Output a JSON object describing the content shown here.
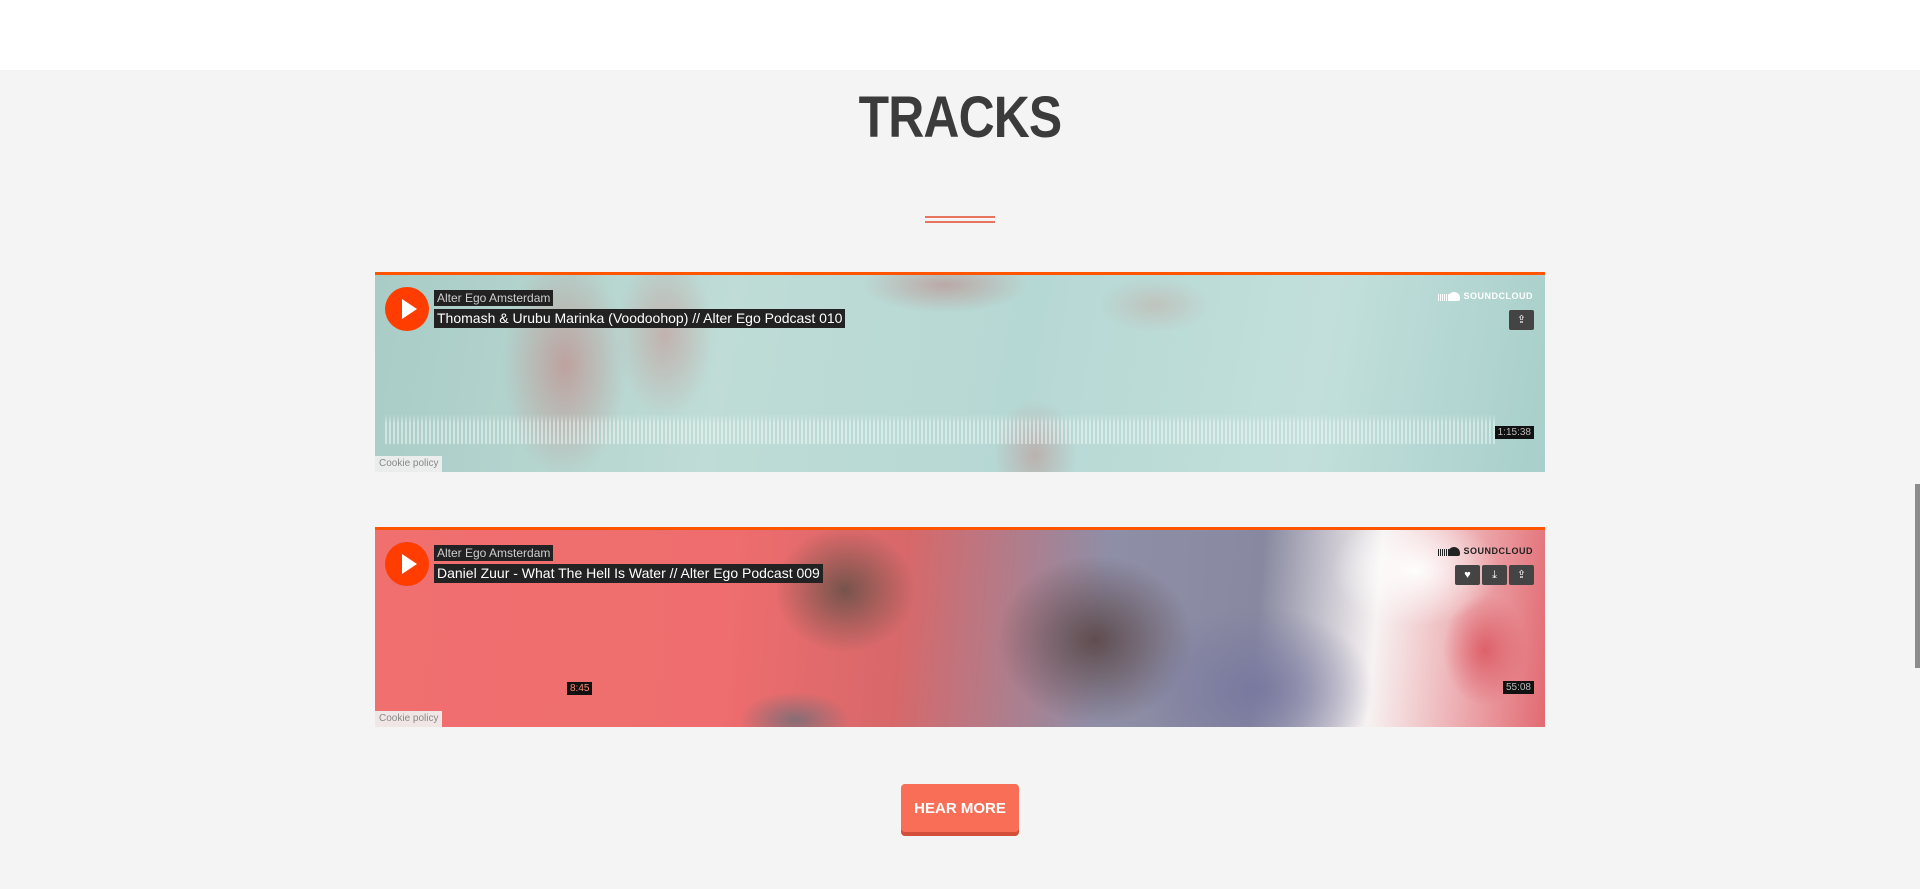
{
  "section": {
    "title": "TRACKS"
  },
  "players": [
    {
      "artist": "Alter Ego Amsterdam",
      "title": "Thomash & Urubu Marinka (Voodoohop) // Alter Ego Podcast 010",
      "brand": "SOUNDCLOUD",
      "duration": "1:15:38",
      "cookie": "Cookie policy",
      "actions": [
        "share-icon"
      ]
    },
    {
      "artist": "Alter Ego Amsterdam",
      "title": "Daniel Zuur - What The Hell Is Water // Alter Ego Podcast 009",
      "brand": "SOUNDCLOUD",
      "duration": "55:08",
      "timestamp": "8:45",
      "cookie": "Cookie policy",
      "actions": [
        "heart-icon",
        "download-icon",
        "share-icon"
      ]
    }
  ],
  "cta": {
    "label": "HEAR MORE"
  },
  "colors": {
    "accent": "#ff5500",
    "button": "#f86e57",
    "title": "#3b3b3b"
  }
}
